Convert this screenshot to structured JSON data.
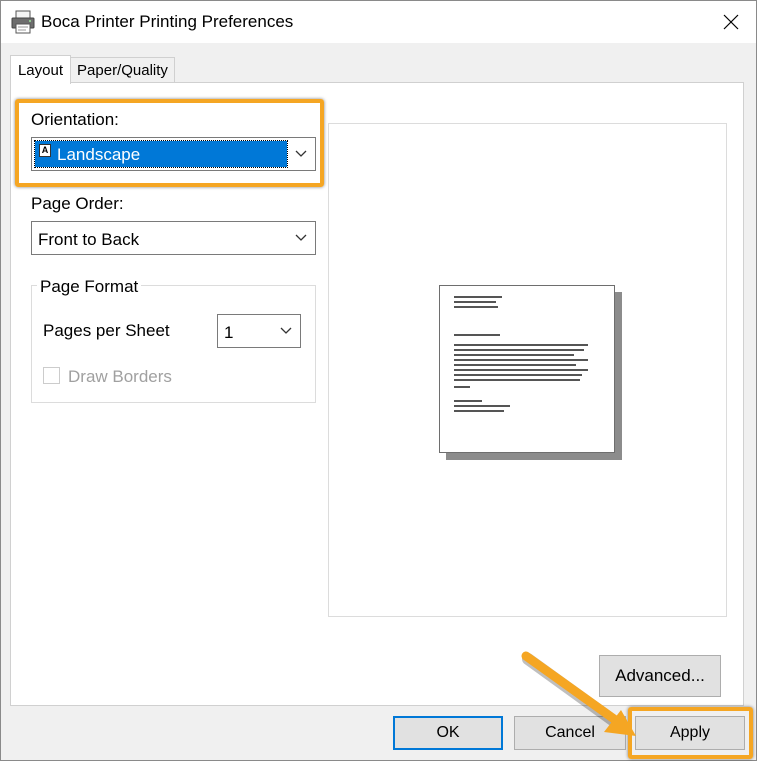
{
  "window": {
    "title": "Boca Printer Printing Preferences",
    "close_icon": "close-icon",
    "app_icon": "printer-icon"
  },
  "tabs": [
    {
      "label": "Layout",
      "selected": true
    },
    {
      "label": "Paper/Quality",
      "selected": false
    }
  ],
  "layout": {
    "orientation_label": "Orientation:",
    "orientation_value": "Landscape",
    "page_order_label": "Page Order:",
    "page_order_value": "Front to Back",
    "page_format_label": "Page Format",
    "pages_per_sheet_label": "Pages per Sheet",
    "pages_per_sheet_value": "1",
    "draw_borders_label": "Draw Borders",
    "draw_borders_checked": false,
    "draw_borders_enabled": false
  },
  "buttons": {
    "advanced": "Advanced...",
    "ok": "OK",
    "cancel": "Cancel",
    "apply": "Apply"
  },
  "colors": {
    "highlight": "#f5a623",
    "selection": "#0078d7"
  }
}
